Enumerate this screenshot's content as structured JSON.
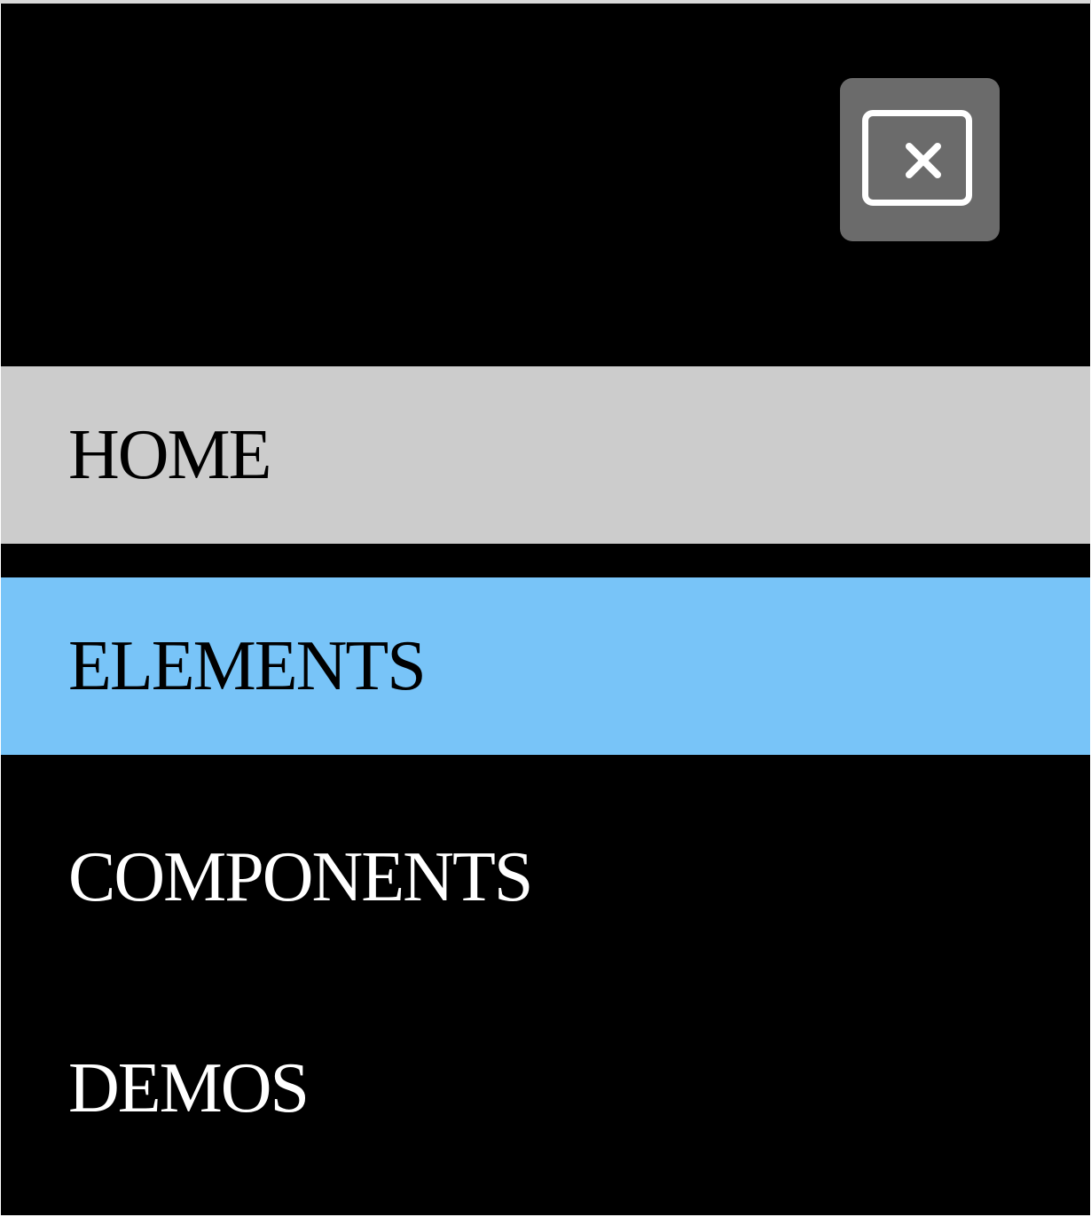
{
  "colors": {
    "panel_background": "#000000",
    "close_button_background": "#6b6b6b",
    "close_icon_color": "#ffffff",
    "item_hover_background": "#cccccc",
    "item_active_background": "#78c4f8",
    "item_text_dark": "#000000",
    "item_text_light": "#ffffff"
  },
  "close_button": {
    "icon": "close-icon"
  },
  "menu": {
    "items": [
      {
        "label": "HOME",
        "state": "hover"
      },
      {
        "label": "ELEMENTS",
        "state": "active"
      },
      {
        "label": "COMPONENTS",
        "state": "normal"
      },
      {
        "label": "DEMOS",
        "state": "normal"
      }
    ]
  }
}
